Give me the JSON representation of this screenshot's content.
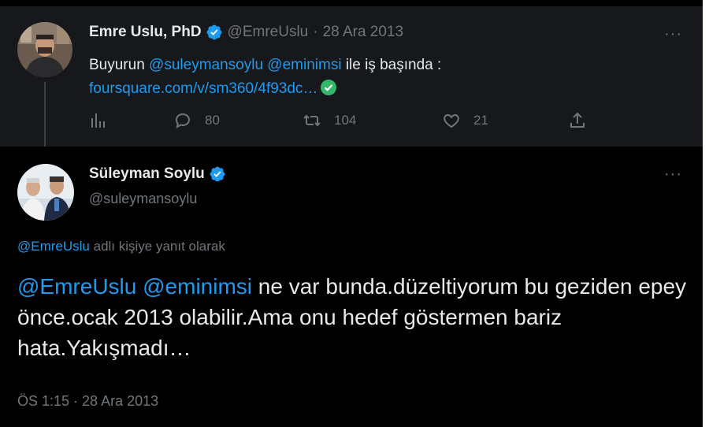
{
  "tweet1": {
    "author_name": "Emre Uslu, PhD",
    "handle": "@EmreUslu",
    "separator": "·",
    "date": "28 Ara 2013",
    "text_prefix": "Buyurun ",
    "mention1": "@suleymansoylu",
    "space": " ",
    "mention2": "@eminimsi",
    "text_suffix": " ile iş başında :",
    "link": "foursquare.com/v/sm360/4f93dc…",
    "more": "···",
    "replies": "80",
    "retweets": "104",
    "likes": "21",
    "icons": {
      "analytics": "analytics-icon",
      "reply": "reply-icon",
      "retweet": "retweet-icon",
      "like": "heart-icon",
      "share": "share-icon"
    }
  },
  "tweet2": {
    "author_name": "Süleyman Soylu",
    "handle": "@suleymansoylu",
    "more": "···",
    "reply_mention": "@EmreUslu",
    "reply_suffix": " adlı kişiye yanıt olarak",
    "mention1": "@EmreUslu",
    "space": " ",
    "mention2": "@eminimsi",
    "text_rest": " ne var bunda.düzeltiyorum bu geziden epey önce.ocak 2013 olabilir.Ama onu hedef göstermen bariz hata.Yakışmadı…",
    "time": "ÖS 1:15",
    "separator": " · ",
    "date": "28 Ara 2013"
  },
  "colors": {
    "background": "#000000",
    "card": "#16181c",
    "text": "#e7e9ea",
    "muted": "#71767b",
    "link": "#1d9bf0",
    "verified": "#1d9bf0"
  }
}
